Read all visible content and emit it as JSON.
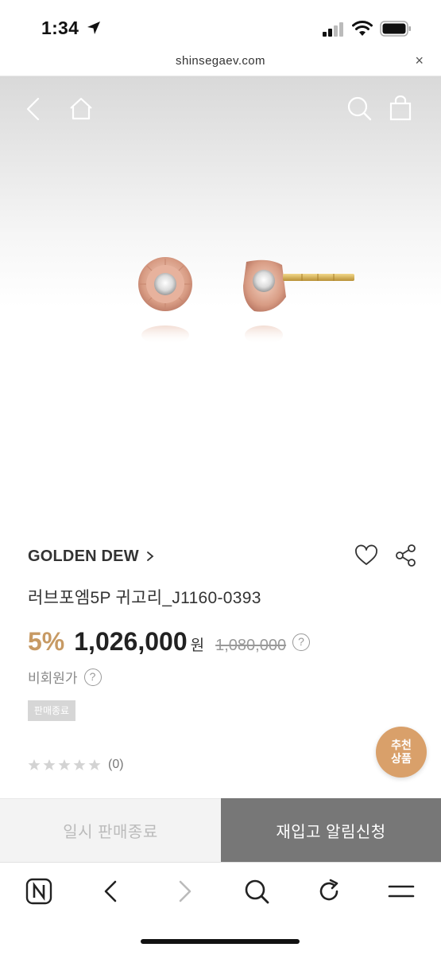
{
  "status_bar": {
    "time": "1:34"
  },
  "browser": {
    "url": "shinsegaev.com",
    "close_label": "×"
  },
  "product": {
    "brand": "GOLDEN DEW",
    "name": "러브포엠5P 귀고리_J1160-0393",
    "discount": "5%",
    "sale_price": "1,026,000",
    "currency": "원",
    "original_price": "1,080,000",
    "member_price_label": "비회원가",
    "help_glyph": "?",
    "status_badge": "판매종료",
    "rating": {
      "stars_filled": 0,
      "stars_total": 5,
      "count": "(0)"
    }
  },
  "recommend_badge": {
    "line1": "추천",
    "line2": "상품"
  },
  "actions": {
    "sold_out_label": "일시 판매종료",
    "restock_alert_label": "재입고 알림신청"
  },
  "colors": {
    "accent": "#c79a64",
    "badge": "#d9a06a",
    "alert_button": "#777777"
  },
  "icons": [
    "back-icon",
    "home-icon",
    "search-icon",
    "cart-icon",
    "heart-icon",
    "share-icon",
    "naver-icon",
    "forward-icon",
    "reload-icon",
    "menu-icon"
  ]
}
